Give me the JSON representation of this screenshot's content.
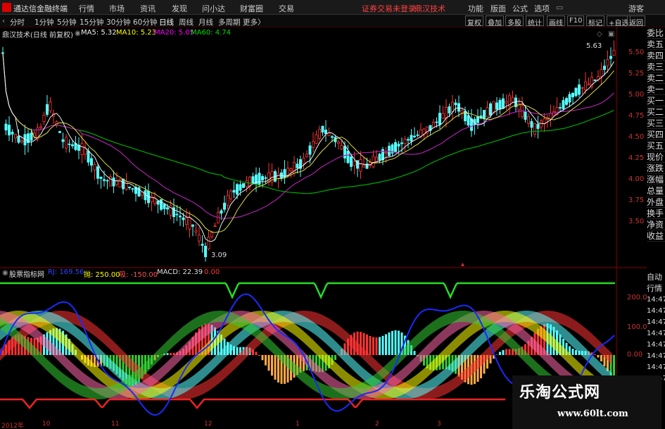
{
  "menubar": {
    "app_title": "通达信金融终端",
    "menus": [
      "行情",
      "市场",
      "资讯",
      "发现",
      "问小达",
      "财富圈",
      "交易"
    ],
    "notice": "证券交易未登录",
    "indicator_name": "鼎汉技术",
    "right_menus": [
      "功能",
      "版面",
      "公式",
      "选项"
    ],
    "guest": "游客"
  },
  "toolbar": {
    "periods": [
      "分时",
      "1分钟",
      "5分钟",
      "15分钟",
      "30分钟",
      "60分钟",
      "日线",
      "周线",
      "月线",
      "多周期",
      "更多"
    ],
    "more_arrow": "〉",
    "right_buttons": [
      "复权",
      "叠加",
      "多股",
      "统计",
      "画线",
      "F10",
      "标记",
      "+自选",
      "返回"
    ]
  },
  "main_chart": {
    "title": "鼎汉技术(日线 前复权)",
    "ma5": "MA5: 5.32",
    "ma10": "MA10: 5.23",
    "ma20": "MA20: 5.05",
    "ma60": "MA60: 4.74",
    "high_label": "5.63",
    "low_label": "3.09",
    "y_ticks": [
      "5.50",
      "5.25",
      "5.00",
      "4.75",
      "4.50",
      "4.25",
      "4.00",
      "3.75",
      "3.50"
    ],
    "colors": {
      "up": "#ff3333",
      "down": "#54ffff",
      "ma5": "#ffffff",
      "ma10": "#ffff00",
      "ma20": "#ff00ff",
      "ma60": "#00cc00"
    }
  },
  "ind_chart": {
    "title": "股票指标网",
    "rj": "RJ: 169.56",
    "buy": "抛: 250.00",
    "sell": "吸: -150.00",
    "macd": "MACD: 22.39",
    "zero": "0.00",
    "y_ticks": [
      "200.0",
      "100.0",
      "0.00"
    ]
  },
  "right_panel": {
    "items": [
      "委比",
      "卖五",
      "卖四",
      "卖三",
      "卖二",
      "卖一",
      "买一",
      "买二",
      "买三",
      "买四",
      "买五",
      "现价",
      "涨跌",
      "涨幅",
      "总量",
      "外盘",
      "换手",
      "净资",
      "收益"
    ],
    "items2": [
      "自动",
      "行情",
      "14:47",
      "14:47",
      "14:47",
      "14:47",
      "14:47",
      "14:47",
      "14:47",
      "14:47"
    ]
  },
  "x_axis": {
    "labels": [
      "2012年",
      "10",
      "11",
      "12",
      "1",
      "2",
      "3"
    ]
  },
  "watermark": {
    "cn": "乐淘公式网",
    "url": "www.60lt.com"
  }
}
